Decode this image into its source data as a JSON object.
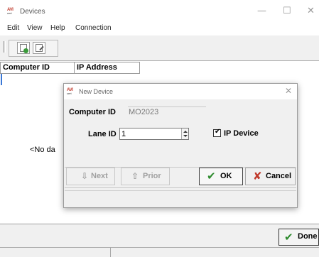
{
  "window": {
    "logo_top": "AVI",
    "logo_bottom": "cert",
    "title": "Devices",
    "minimize_glyph": "—",
    "maximize_glyph": "☐",
    "close_glyph": "✕"
  },
  "menu": [
    {
      "label": "Edit"
    },
    {
      "label": "View"
    },
    {
      "label": "Help"
    },
    {
      "label": "Connection"
    }
  ],
  "toolbar": {
    "buttons": [
      {
        "icon": "new-record-icon"
      },
      {
        "icon": "edit-record-icon"
      }
    ]
  },
  "grid": {
    "columns": [
      "Computer ID",
      "IP Address"
    ],
    "empty_text": "<No da"
  },
  "main": {
    "done_label": "Done",
    "done_icon": "✔"
  },
  "dialog": {
    "logo_top": "AVI",
    "logo_bottom": "cert",
    "title": "New Device",
    "close_glyph": "✕",
    "computer_id_label": "Computer ID",
    "computer_id_value": "MO2023",
    "lane_id_label": "Lane ID",
    "lane_id_value": "1",
    "ip_device_label": "IP Device",
    "ip_device_checked": true,
    "check_glyph": "✔",
    "next_label": "Next",
    "prior_label": "Prior",
    "ok_label": "OK",
    "cancel_label": "Cancel",
    "next_icon": "⇩",
    "prior_icon": "⇧",
    "ok_icon": "✔",
    "cancel_icon": "✘"
  },
  "colors": {
    "ok_green": "#2e8b2e",
    "cancel_red": "#c0392b",
    "logo_red": "#c0392b",
    "selection_blue": "#3a78d6"
  }
}
